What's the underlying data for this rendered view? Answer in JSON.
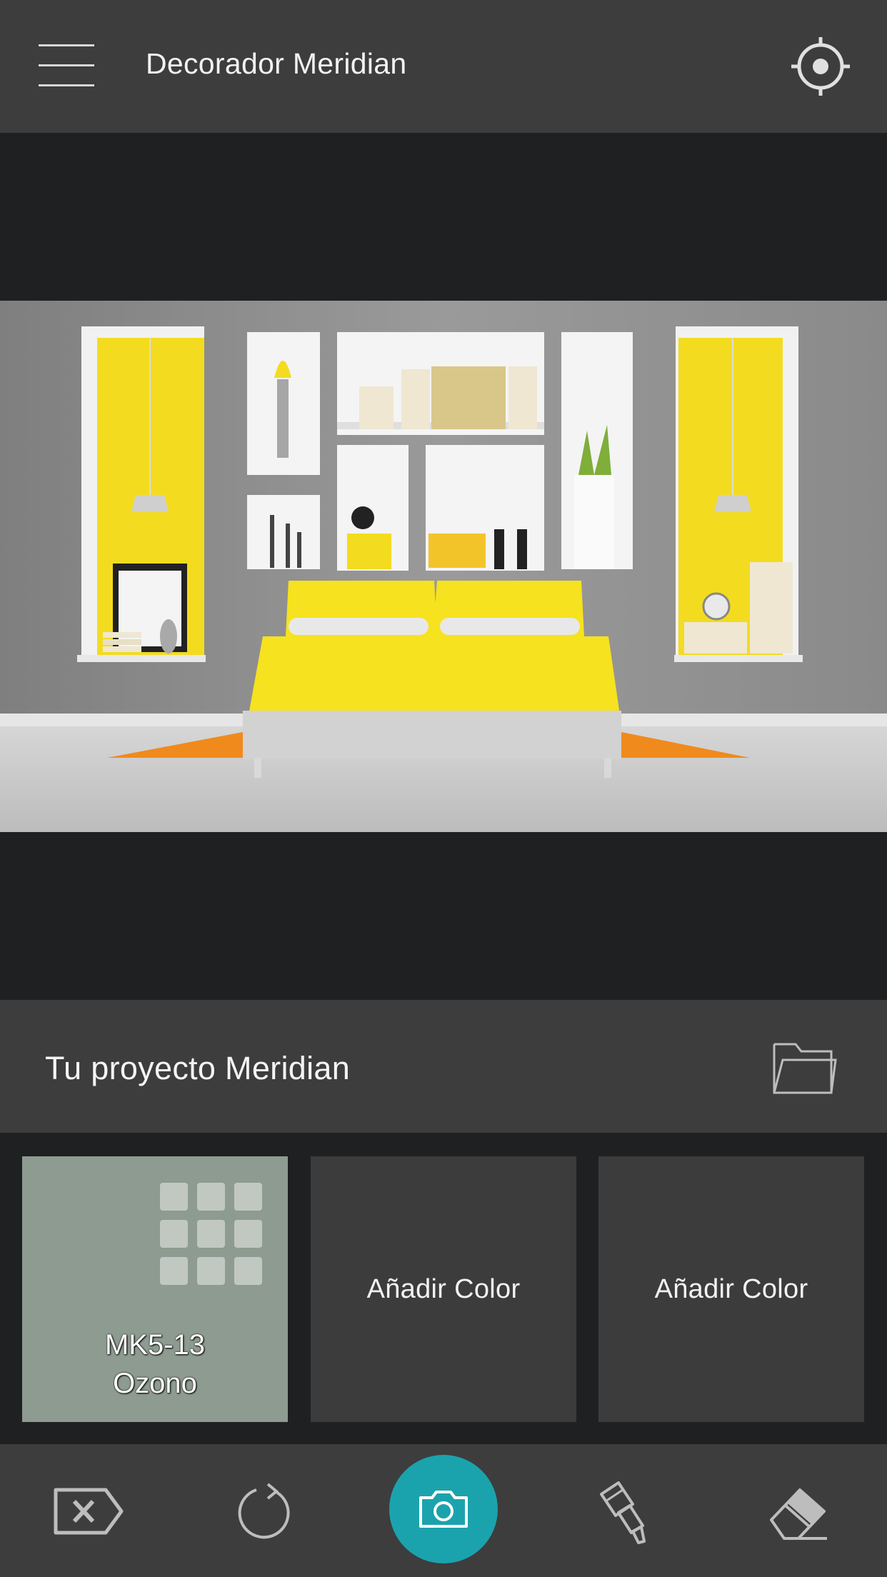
{
  "header": {
    "title": "Decorador Meridian"
  },
  "project": {
    "title": "Tu proyecto Meridian"
  },
  "swatches": [
    {
      "code": "MK5-13",
      "name": "Ozono",
      "color": "#8e9b90"
    },
    {
      "label": "Añadir Color"
    },
    {
      "label": "Añadir Color"
    }
  ],
  "toolbar": {
    "icons": [
      "clear-tag-icon",
      "undo-icon",
      "camera-icon",
      "paint-brush-icon",
      "eraser-icon"
    ],
    "accent": "#1ba3ad"
  },
  "colors": {
    "bar": "#3d3d3d",
    "background": "#1f2022",
    "accent_yellow": "#f3dc1f"
  }
}
